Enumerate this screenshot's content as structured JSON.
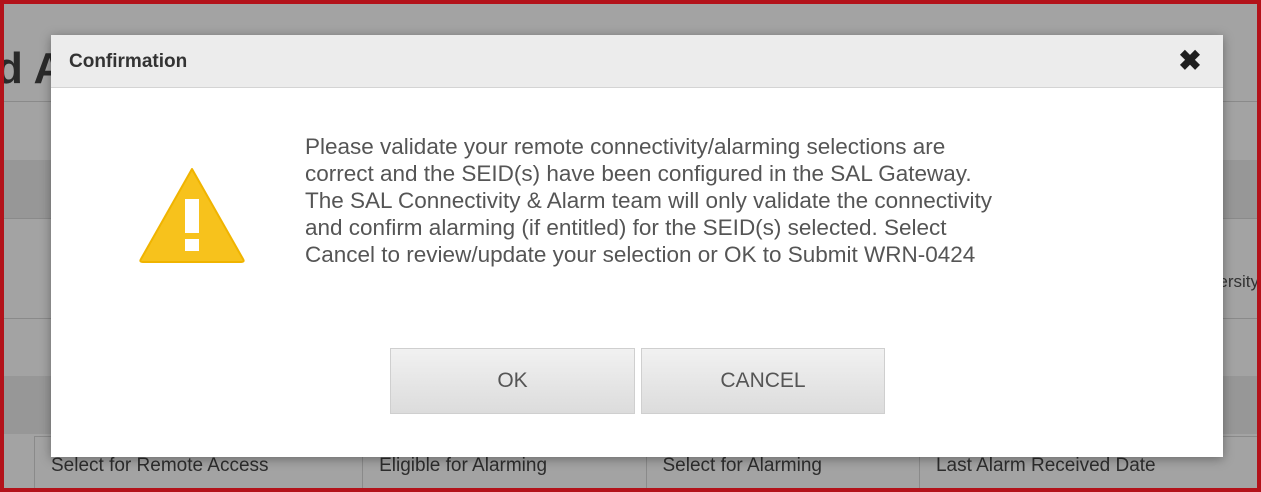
{
  "background": {
    "title_fragment": "d A",
    "side_text": "ersity",
    "table_headers": [
      "Select for Remote Access",
      "Eligible for Alarming",
      "Select for Alarming",
      "Last Alarm Received Date"
    ]
  },
  "dialog": {
    "title": "Confirmation",
    "close_glyph": "✖",
    "icon": "warning-triangle-icon",
    "message_lines": [
      "Please validate your remote connectivity/alarming selections are",
      "correct and the SEID(s) have been configured in the SAL Gateway.",
      "The SAL Connectivity & Alarm team will only validate the connectivity",
      "and confirm alarming (if entitled) for the SEID(s) selected. Select",
      "Cancel to review/update your selection or OK to Submit WRN-0424"
    ],
    "ok_label": "OK",
    "cancel_label": "CANCEL"
  },
  "colors": {
    "frame_border": "#b3121a",
    "warning_fill": "#f7c21c",
    "overlay": "#a3a3a3"
  }
}
